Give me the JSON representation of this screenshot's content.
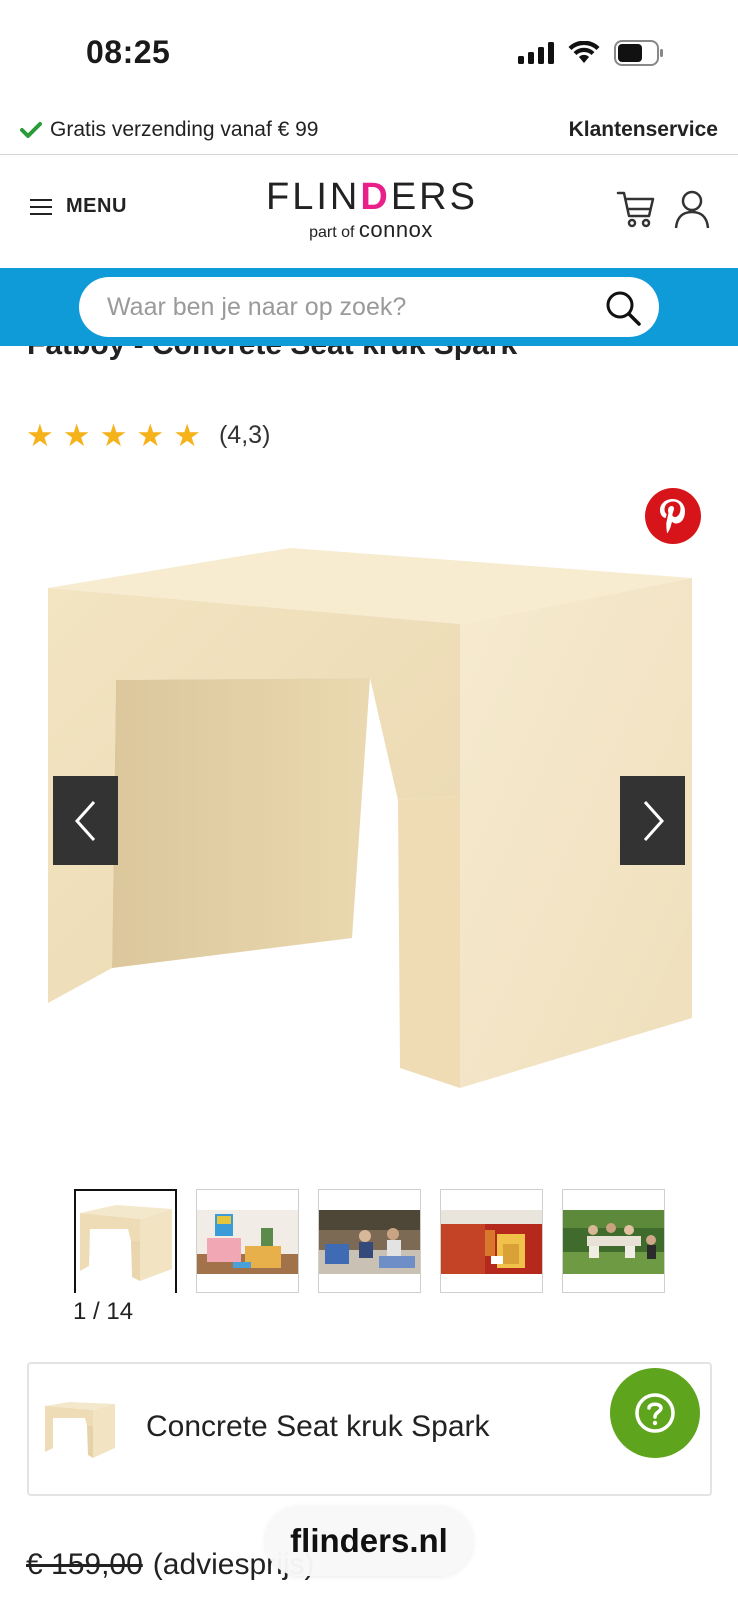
{
  "status_bar": {
    "time": "08:25"
  },
  "usp_bar": {
    "shipping_text": "Gratis verzending vanaf € 99",
    "customer_service": "Klantenservice"
  },
  "header": {
    "menu_label": "MENU",
    "logo_main_left": "FLIN",
    "logo_main_d": "D",
    "logo_main_right": "ERS",
    "logo_sub_prefix": "part of",
    "logo_sub_brand": "connox"
  },
  "search": {
    "placeholder": "Waar ben je naar op zoek?"
  },
  "product": {
    "title": "Fatboy - Concrete Seat kruk Spark",
    "rating_value": 5,
    "rating_max": 5,
    "rating_text": "(4,3)",
    "gallery_counter": "1 / 14",
    "card_name": "Concrete Seat kruk Spark",
    "old_price": "€ 159,00",
    "price_note": "(adviesprijs)"
  },
  "thumbnails": [
    {
      "name": "thumb-1-concrete-seat"
    },
    {
      "name": "thumb-2-kids-room"
    },
    {
      "name": "thumb-3-outdoor-picnic"
    },
    {
      "name": "thumb-4-bedroom"
    },
    {
      "name": "thumb-5-garden-party"
    }
  ],
  "browser": {
    "url": "flinders.nl"
  },
  "colors": {
    "search_band": "#0f9bd7",
    "star": "#f6b21b",
    "pinterest": "#d7141a",
    "help_button": "#5fa41d",
    "check": "#2a9d3a"
  },
  "icons": {
    "check": "check-icon",
    "menu": "hamburger-icon",
    "cart": "cart-icon",
    "user": "user-icon",
    "search": "search-icon",
    "pinterest": "pinterest-icon",
    "prev": "chevron-left-icon",
    "next": "chevron-right-icon",
    "help": "question-icon"
  }
}
